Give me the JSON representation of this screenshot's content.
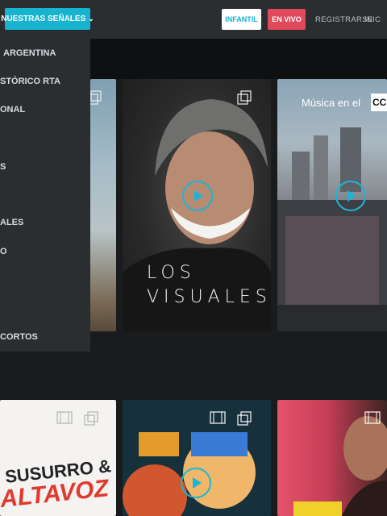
{
  "header": {
    "signals_button": "NUESTRAS SEÑALES",
    "infantil_button": "INFANTIL",
    "envivo_button": "EN VIVO",
    "register_link": "REGISTRARSE",
    "home_link": "INIC"
  },
  "signals_menu": {
    "items": [
      {
        "label": "ARGENTINA"
      },
      {
        "label": "STÓRICO RTA"
      },
      {
        "label": "ONAL"
      },
      {
        "label": "S"
      },
      {
        "label": "ALES"
      },
      {
        "label": "O"
      },
      {
        "label": "CORTOS"
      }
    ]
  },
  "cards": {
    "los_visuales": {
      "line1": "LOS",
      "line2": "VISUALES"
    },
    "musica": {
      "title": "Música en el",
      "badge": "CC"
    },
    "susurro": {
      "line1": "SUSURRO &",
      "line2": "ALTAVOZ"
    }
  },
  "colors": {
    "accent": "#17b3cf",
    "live": "#e04a5c",
    "topbar": "#2b2e31",
    "background": "#1a1b1d"
  },
  "icons": {
    "dropdown_chevron": "chevron-down-icon",
    "multi": "multi-episode-icon",
    "film": "film-icon",
    "play": "play-icon"
  }
}
